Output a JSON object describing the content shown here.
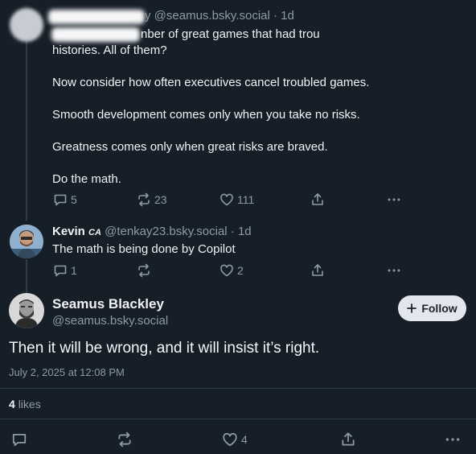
{
  "post1": {
    "handle_partial": "y @seamus.bsky.social · 1d",
    "line1_partial": "nber of great games that had trou",
    "line2": "histories. All of them?",
    "line3": "Now consider how often executives cancel troubled games.",
    "line4": "Smooth development comes only when you take no risks.",
    "line5": "Greatness comes only when great risks are braved.",
    "line6": "Do the math.",
    "replies": "5",
    "reposts": "23",
    "likes": "111"
  },
  "post2": {
    "name": "Kevin",
    "flag": "CA",
    "handle": "@tenkay23.bsky.social · 1d",
    "text": "The math is being done by Copilot",
    "replies": "1",
    "reposts": "",
    "likes": "2"
  },
  "main": {
    "name": "Seamus Blackley",
    "handle": "@seamus.bsky.social",
    "follow_label": "Follow",
    "text": "Then it will be wrong, and it will insist it’s right.",
    "timestamp": "July 2, 2025 at 12:08 PM",
    "likes_count": "4",
    "likes_label": "likes",
    "bar_likes": "4"
  },
  "icons": [
    "reply-icon",
    "repost-icon",
    "like-icon",
    "share-icon",
    "more-icon",
    "plus-icon"
  ]
}
